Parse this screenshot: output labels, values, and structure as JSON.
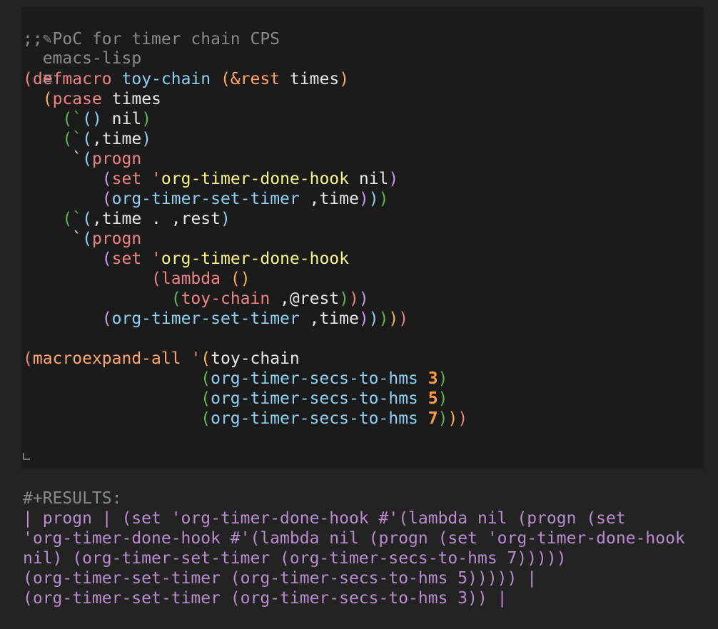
{
  "header": {
    "icon": "pencil-icon",
    "language": "emacs-lisp",
    "menu_icon": "≡"
  },
  "code": {
    "comment": ";; PoC for timer chain CPS",
    "lines": [
      [
        {
          "t": "(",
          "c": "p1"
        },
        {
          "t": "defmacro",
          "c": "kw"
        },
        {
          "t": " "
        },
        {
          "t": "toy-chain",
          "c": "fn"
        },
        {
          "t": " "
        },
        {
          "t": "(",
          "c": "p2"
        },
        {
          "t": "&rest",
          "c": "kwp"
        },
        {
          "t": " times",
          "c": "wht"
        },
        {
          "t": ")",
          "c": "p2"
        }
      ],
      [
        {
          "t": "  "
        },
        {
          "t": "(",
          "c": "p2"
        },
        {
          "t": "pcase",
          "c": "kw"
        },
        {
          "t": " times",
          "c": "wht"
        }
      ],
      [
        {
          "t": "    "
        },
        {
          "t": "(",
          "c": "p3"
        },
        {
          "t": "`",
          "c": "p3"
        },
        {
          "t": "(",
          "c": "p4"
        },
        {
          "t": ")",
          "c": "p4"
        },
        {
          "t": " nil",
          "c": "wht"
        },
        {
          "t": ")",
          "c": "p3"
        }
      ],
      [
        {
          "t": "    "
        },
        {
          "t": "(",
          "c": "p3"
        },
        {
          "t": "`",
          "c": "p3"
        },
        {
          "t": "(",
          "c": "p4"
        },
        {
          "t": ",time",
          "c": "wht"
        },
        {
          "t": ")",
          "c": "p4"
        }
      ],
      [
        {
          "t": "     "
        },
        {
          "t": "`",
          "c": "wht"
        },
        {
          "t": "(",
          "c": "p4"
        },
        {
          "t": "progn",
          "c": "kw"
        }
      ],
      [
        {
          "t": "        "
        },
        {
          "t": "(",
          "c": "p5"
        },
        {
          "t": "set",
          "c": "kw"
        },
        {
          "t": " "
        },
        {
          "t": "'",
          "c": "kw"
        },
        {
          "t": "org-timer-done-hook",
          "c": "str"
        },
        {
          "t": " nil",
          "c": "wht"
        },
        {
          "t": ")",
          "c": "p5"
        }
      ],
      [
        {
          "t": "        "
        },
        {
          "t": "(",
          "c": "p5"
        },
        {
          "t": "org-timer-set-timer",
          "c": "fn"
        },
        {
          "t": " ,time",
          "c": "wht"
        },
        {
          "t": ")",
          "c": "p5"
        },
        {
          "t": ")",
          "c": "p4"
        },
        {
          "t": ")",
          "c": "p3"
        }
      ],
      [
        {
          "t": "    "
        },
        {
          "t": "(",
          "c": "p3"
        },
        {
          "t": "`",
          "c": "p3"
        },
        {
          "t": "(",
          "c": "p4"
        },
        {
          "t": ",time . ,rest",
          "c": "wht"
        },
        {
          "t": ")",
          "c": "p4"
        }
      ],
      [
        {
          "t": "     "
        },
        {
          "t": "`",
          "c": "wht"
        },
        {
          "t": "(",
          "c": "p4"
        },
        {
          "t": "progn",
          "c": "kw"
        }
      ],
      [
        {
          "t": "        "
        },
        {
          "t": "(",
          "c": "p5"
        },
        {
          "t": "set",
          "c": "kw"
        },
        {
          "t": " "
        },
        {
          "t": "'",
          "c": "kw"
        },
        {
          "t": "org-timer-done-hook",
          "c": "str"
        }
      ],
      [
        {
          "t": "             "
        },
        {
          "t": "(",
          "c": "p1"
        },
        {
          "t": "lambda",
          "c": "kw"
        },
        {
          "t": " "
        },
        {
          "t": "(",
          "c": "p2"
        },
        {
          "t": ")",
          "c": "p2"
        }
      ],
      [
        {
          "t": "               "
        },
        {
          "t": "(",
          "c": "p3"
        },
        {
          "t": "toy-chain",
          "c": "kw"
        },
        {
          "t": " ,@rest",
          "c": "wht"
        },
        {
          "t": ")",
          "c": "p3"
        },
        {
          "t": ")",
          "c": "p1"
        },
        {
          "t": ")",
          "c": "p5"
        }
      ],
      [
        {
          "t": "        "
        },
        {
          "t": "(",
          "c": "p5"
        },
        {
          "t": "org-timer-set-timer",
          "c": "fn"
        },
        {
          "t": " ,time",
          "c": "wht"
        },
        {
          "t": ")",
          "c": "p5"
        },
        {
          "t": ")",
          "c": "p4"
        },
        {
          "t": ")",
          "c": "p3"
        },
        {
          "t": ")",
          "c": "p2"
        },
        {
          "t": ")",
          "c": "p1"
        }
      ],
      [],
      [
        {
          "t": "(",
          "c": "p1"
        },
        {
          "t": "macroexpand-all",
          "c": "kwp"
        },
        {
          "t": " "
        },
        {
          "t": "'",
          "c": "kw"
        },
        {
          "t": "(",
          "c": "p2"
        },
        {
          "t": "toy-chain",
          "c": "wht"
        }
      ],
      [
        {
          "t": "                  "
        },
        {
          "t": "(",
          "c": "p3"
        },
        {
          "t": "org-timer-secs-to-hms",
          "c": "fn"
        },
        {
          "t": " "
        },
        {
          "t": "3",
          "c": "num"
        },
        {
          "t": ")",
          "c": "p3"
        }
      ],
      [
        {
          "t": "                  "
        },
        {
          "t": "(",
          "c": "p3"
        },
        {
          "t": "org-timer-secs-to-hms",
          "c": "fn"
        },
        {
          "t": " "
        },
        {
          "t": "5",
          "c": "num"
        },
        {
          "t": ")",
          "c": "p3"
        }
      ],
      [
        {
          "t": "                  "
        },
        {
          "t": "(",
          "c": "p3"
        },
        {
          "t": "org-timer-secs-to-hms",
          "c": "fn"
        },
        {
          "t": " "
        },
        {
          "t": "7",
          "c": "num"
        },
        {
          "t": ")",
          "c": "p3"
        },
        {
          "t": ")",
          "c": "p2"
        },
        {
          "t": ")",
          "c": "p1"
        }
      ]
    ]
  },
  "results": {
    "header": "#+RESULTS:",
    "lines": [
      "| progn | (set 'org-timer-done-hook #'(lambda nil (progn (set",
      "'org-timer-done-hook #'(lambda nil (progn (set 'org-timer-done-hook",
      "nil) (org-timer-set-timer (org-timer-secs-to-hms 7)))))",
      "(org-timer-set-timer (org-timer-secs-to-hms 5))))) |",
      "(org-timer-set-timer (org-timer-secs-to-hms 3)) |"
    ]
  }
}
